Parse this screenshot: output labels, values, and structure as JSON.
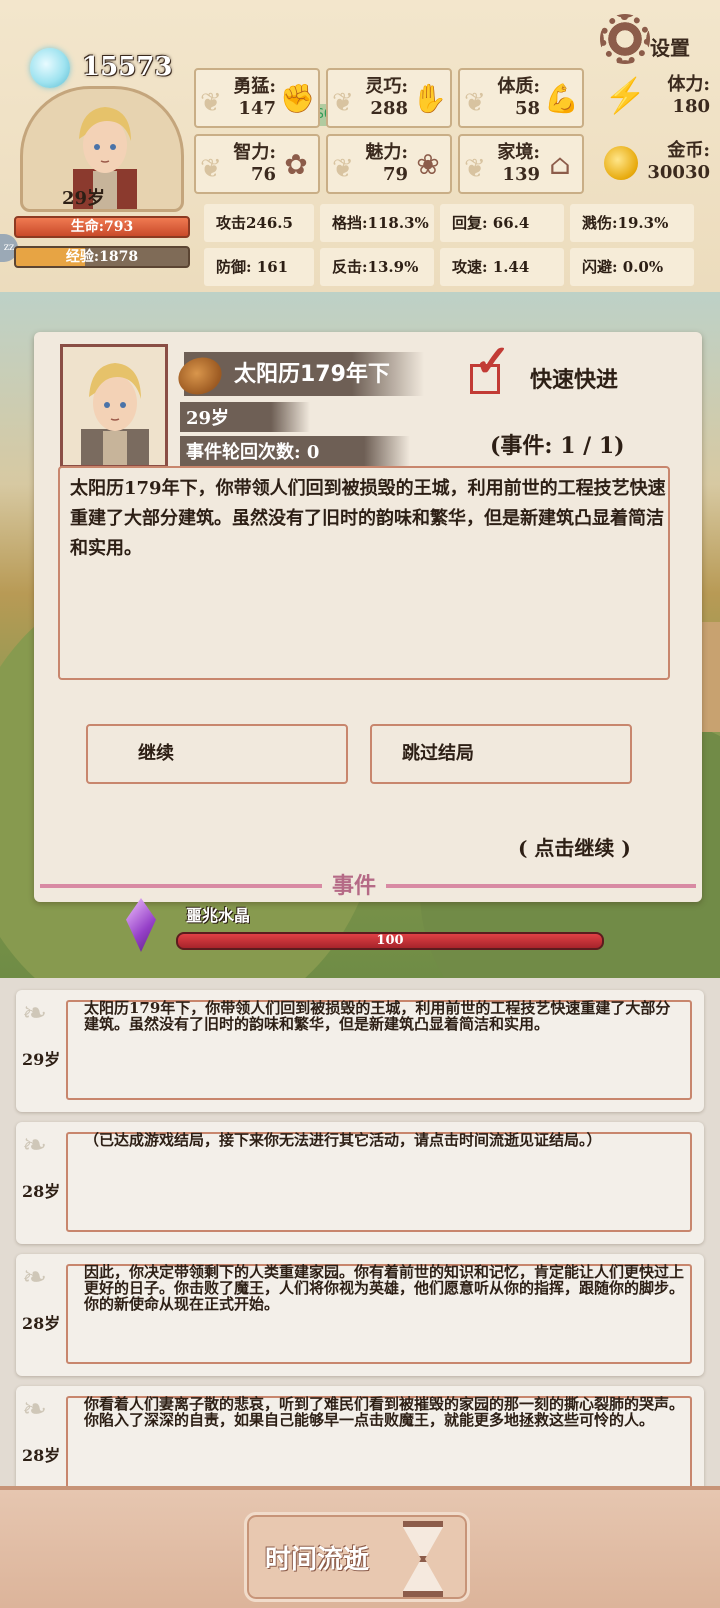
{
  "header": {
    "soul_count": "15573",
    "age": "29岁",
    "hp": "生命:793",
    "xp": "经验:1878",
    "settings_label": "设置",
    "fps": "FPS60",
    "attributes": [
      {
        "label": "勇猛:",
        "value": "147",
        "icon": "fist-icon"
      },
      {
        "label": "灵巧:",
        "value": "288",
        "icon": "hand-icon"
      },
      {
        "label": "体质:",
        "value": "58",
        "icon": "arm-icon"
      },
      {
        "label": "智力:",
        "value": "76",
        "icon": "brain-icon"
      },
      {
        "label": "魅力:",
        "value": "79",
        "icon": "lotus-icon"
      },
      {
        "label": "家境:",
        "value": "139",
        "icon": "home-icon"
      }
    ],
    "resources": [
      {
        "label": "体力:",
        "value": "180",
        "icon": "lightning-icon"
      },
      {
        "label": "金币:",
        "value": "30030",
        "icon": "coin-icon"
      }
    ],
    "combat_stats": [
      "攻击246.5",
      "格挡:118.3%",
      "回复:  66.4",
      "溅伤:19.3%",
      "防御:  161",
      "反击:13.9%",
      "攻速:  1.44",
      "闪避:  0.0%"
    ],
    "xp_fraction": 0.4
  },
  "event": {
    "date": "太阳历179年下",
    "age": "29岁",
    "cycle": "事件轮回次数: 0",
    "fast_forward_label": "快速快进",
    "fast_forward_checked": true,
    "counter": "(事件: 1 / 1)",
    "text": "太阳历179年下，你带领人们回到被损毁的王城，利用前世的工程技艺快速重建了大部分建筑。虽然没有了旧时的韵味和繁华，但是新建筑凸显着简洁和实用。",
    "continue_label": "继续",
    "skip_label": "跳过结局",
    "tap_hint": "( 点击继续 )",
    "section_label": "事件"
  },
  "crystal": {
    "label": "噩兆水晶",
    "value": "100",
    "fraction": 1.0
  },
  "log": [
    {
      "age": "29岁",
      "text": "太阳历179年下，你带领人们回到被损毁的王城，利用前世的工程技艺快速重建了大部分建筑。虽然没有了旧时的韵味和繁华，但是新建筑凸显着简洁和实用。"
    },
    {
      "age": "28岁",
      "text": "（已达成游戏结局，接下来你无法进行其它活动，请点击时间流逝见证结局。）"
    },
    {
      "age": "28岁",
      "text": "因此，你决定带领剩下的人类重建家园。你有着前世的知识和记忆，肯定能让人们更快过上更好的日子。你击败了魔王，人们将你视为英雄，他们愿意听从你的指挥，跟随你的脚步。你的新使命从现在正式开始。"
    },
    {
      "age": "28岁",
      "text": "你看着人们妻离子散的悲哀，听到了难民们看到被摧毁的家园的那一刻的撕心裂肺的哭声。你陷入了深深的自责，如果自己能够早一点击败魔王，就能更多地拯救这些可怜的人。"
    }
  ],
  "footer": {
    "time_label": "时间流逝"
  },
  "colors": {
    "hp": "#c94a2a",
    "xp": "#e7a444",
    "accent_red": "#c23b35",
    "frame_pink": "#c8866d"
  }
}
